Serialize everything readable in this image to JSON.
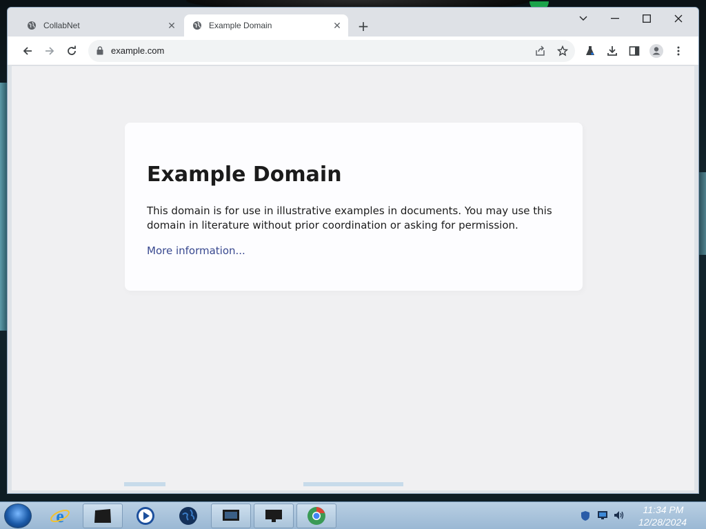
{
  "browser": {
    "tabs": [
      {
        "title": "CollabNet",
        "icon": "globe-icon",
        "active": false
      },
      {
        "title": "Example Domain",
        "icon": "globe-icon",
        "active": true
      }
    ],
    "new_tab_icon": "plus-icon",
    "address_bar": {
      "url": "example.com",
      "icon": "lock-icon"
    },
    "toolbar_icons": [
      "back-arrow-icon",
      "forward-arrow-icon",
      "reload-icon",
      "share-icon",
      "star-icon",
      "labs-flask-icon",
      "download-icon",
      "side-panel-icon",
      "profile-icon",
      "kebab-menu-icon"
    ],
    "window_controls": [
      "chevron-down-icon",
      "minimize-icon",
      "maximize-icon",
      "close-icon"
    ]
  },
  "page": {
    "heading": "Example Domain",
    "body": "This domain is for use in illustrative examples in documents. You may use this domain in literature without prior coordination or asking for permission.",
    "link": "More information..."
  },
  "taskbar": {
    "items": [
      "start-orb-icon",
      "internet-explorer-icon",
      "file-explorer-icon",
      "media-player-icon",
      "globe-app-icon",
      "monitor-app-icon",
      "display-app-icon",
      "chrome-icon"
    ],
    "tray": [
      "shield-icon",
      "network-icon",
      "volume-icon"
    ],
    "clock_time": "11:34 PM",
    "clock_date": "12/28/2024"
  },
  "colors": {
    "link": "#38488f",
    "page_bg": "#f0f0f2",
    "tabstrip_bg": "#dee1e6",
    "taskbar_bg": "#a9c3da"
  }
}
